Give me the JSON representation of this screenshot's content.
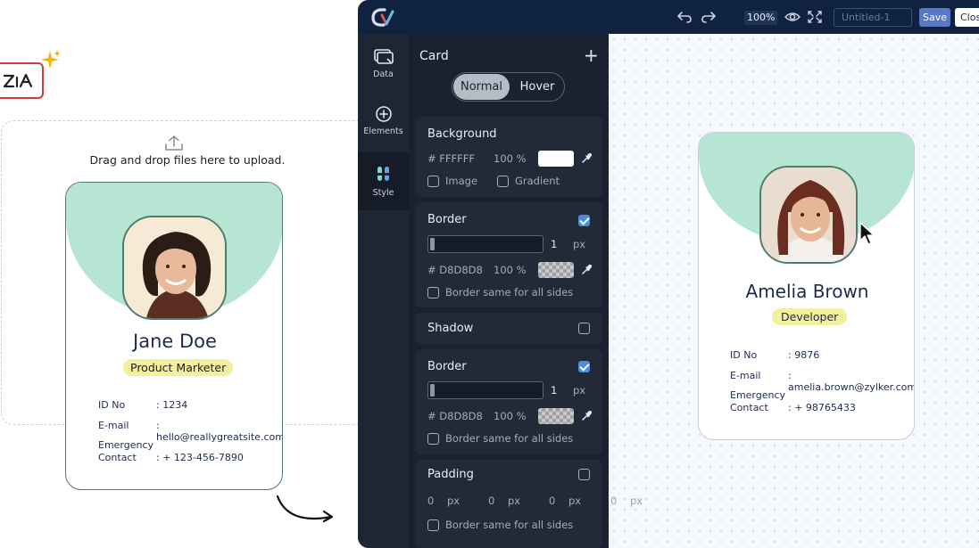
{
  "upload": {
    "text": "Drag and drop files here to upload."
  },
  "left_card": {
    "name": "Jane Doe",
    "role": "Product Marketer",
    "rows": [
      {
        "label": "ID No",
        "value": ": 1234"
      },
      {
        "label": "E-mail",
        "value": ": hello@reallygreatsite.com"
      },
      {
        "label": "Emergency",
        "value": ""
      },
      {
        "label": "Contact",
        "value": ": + 123-456-7890"
      }
    ]
  },
  "topbar": {
    "zoom": "100%",
    "title_placeholder": "Untitled-1",
    "save_label": "Save",
    "close_label": "Close"
  },
  "leftbar": {
    "items": [
      {
        "label": "Data",
        "icon": "data-icon"
      },
      {
        "label": "Elements",
        "icon": "plus-circle-icon"
      },
      {
        "label": "Style",
        "icon": "style-icon"
      }
    ]
  },
  "panel": {
    "title": "Card",
    "tabs": {
      "normal": "Normal",
      "hover": "Hover"
    },
    "background": {
      "title": "Background",
      "hex": "# FFFFFF",
      "opacity": "100 %",
      "image_label": "Image",
      "gradient_label": "Gradient"
    },
    "border1": {
      "title": "Border",
      "width": "1",
      "unit": "px",
      "hex": "# D8D8D8",
      "opacity": "100 %",
      "same_sides": "Border same for all sides"
    },
    "shadow": {
      "title": "Shadow"
    },
    "border2": {
      "title": "Border",
      "width": "1",
      "unit": "px",
      "hex": "# D8D8D8",
      "opacity": "100 %",
      "same_sides": "Border same for all sides"
    },
    "padding": {
      "title": "Padding",
      "values": [
        "0",
        "0",
        "0",
        "0"
      ],
      "unit": "px",
      "same_sides": "Border same for all sides"
    }
  },
  "right_card": {
    "name": "Amelia Brown",
    "role": "Developer",
    "rows": [
      {
        "label": "ID No",
        "value": ": 9876"
      },
      {
        "label": "E-mail",
        "value": ": amelia.brown@zylker.com"
      },
      {
        "label": "Emergency",
        "value": ""
      },
      {
        "label": "Contact",
        "value": ": + 98765433"
      }
    ]
  },
  "colors": {
    "accent_mint": "#b6e6d3",
    "role_yellow": "#f3ef9c",
    "topbar_navy": "#0f2341",
    "save_blue": "#5a78c8",
    "check_blue": "#4a90d9"
  }
}
